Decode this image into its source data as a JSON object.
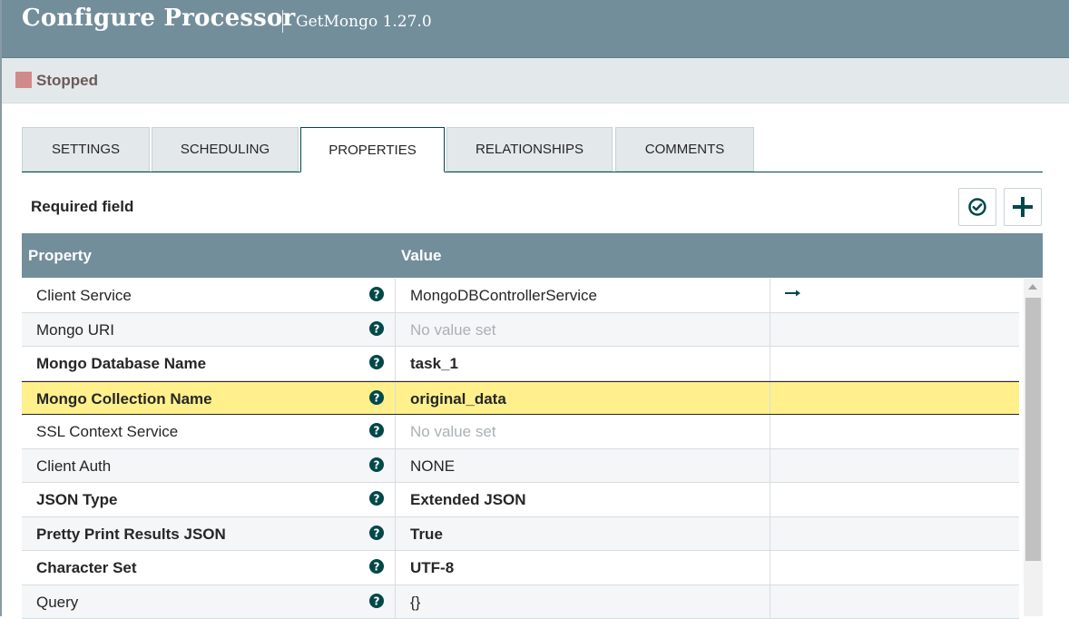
{
  "header": {
    "title": "Configure Processor",
    "subtitle": "GetMongo 1.27.0"
  },
  "status": {
    "label": "Stopped",
    "color": "#d08a8a"
  },
  "tabs": [
    {
      "label": "SETTINGS"
    },
    {
      "label": "SCHEDULING"
    },
    {
      "label": "PROPERTIES",
      "active": true
    },
    {
      "label": "RELATIONSHIPS"
    },
    {
      "label": "COMMENTS"
    }
  ],
  "required_label": "Required field",
  "toolbar": {
    "verify_icon": "check-circle-icon",
    "add_icon": "plus-icon"
  },
  "table": {
    "headers": {
      "property": "Property",
      "value": "Value"
    },
    "rows": [
      {
        "name": "Client Service",
        "value": "MongoDBControllerService",
        "required": false,
        "has_link": true
      },
      {
        "name": "Mongo URI",
        "value": "No value set",
        "empty": true,
        "required": false
      },
      {
        "name": "Mongo Database Name",
        "value": "task_1",
        "required": true
      },
      {
        "name": "Mongo Collection Name",
        "value": "original_data",
        "required": true,
        "selected": true
      },
      {
        "name": "SSL Context Service",
        "value": "No value set",
        "empty": true,
        "required": false
      },
      {
        "name": "Client Auth",
        "value": "NONE",
        "required": false
      },
      {
        "name": "JSON Type",
        "value": "Extended JSON",
        "required": true
      },
      {
        "name": "Pretty Print Results JSON",
        "value": "True",
        "required": true
      },
      {
        "name": "Character Set",
        "value": "UTF-8",
        "required": true
      },
      {
        "name": "Query",
        "value": "{}",
        "required": false
      }
    ]
  },
  "colors": {
    "accent": "#004849",
    "header_bg": "#728e9b",
    "highlight": "#fff08c"
  }
}
